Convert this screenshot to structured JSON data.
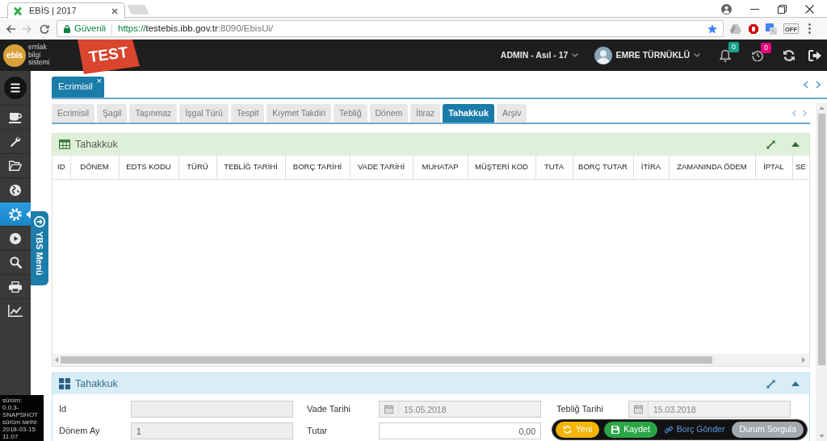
{
  "browser": {
    "tab_title": "EBİS | 2017",
    "forward_disabled": true,
    "security_label": "Güvenli",
    "url": {
      "scheme": "https://",
      "host": "testebis.ibb.gov.tr",
      "path": ":8090/EbisUi/"
    },
    "extension_label": "OFF"
  },
  "header": {
    "logo": "ebis",
    "tagline": [
      "emlak",
      "bilgi",
      "sistemi"
    ],
    "environment": "TEST",
    "role": "ADMIN - Asıl - 17",
    "user": "EMRE TÜRNÜKLÜ",
    "indicators": [
      {
        "badge": "0",
        "color": "#1aa38b"
      },
      {
        "badge": "0",
        "color": "#e6007e"
      }
    ]
  },
  "sidebar": {
    "items": [
      {
        "selected": false
      },
      {
        "selected": false
      },
      {
        "selected": false
      },
      {
        "selected": false
      },
      {
        "selected": true
      },
      {
        "selected": false
      },
      {
        "selected": false
      },
      {
        "selected": false
      },
      {
        "selected": false
      }
    ],
    "side_tab": "YBS Menü",
    "build_info": [
      {
        "label": "sürüm:",
        "value": "0.0.3-SNAPSHOT"
      },
      {
        "label": "sürüm tarihi:",
        "value": "2018-03-15 11:07"
      }
    ]
  },
  "page_tabs": [
    {
      "label": "Ecrimisil",
      "close": "×",
      "selected": true
    }
  ],
  "sub_tabs": [
    {
      "label": "Ecrimisil",
      "selected": false
    },
    {
      "label": "Şagil",
      "selected": false
    },
    {
      "label": "Taşınmaz",
      "selected": false
    },
    {
      "label": "İşgal Türü",
      "selected": false
    },
    {
      "label": "Tespit",
      "selected": false
    },
    {
      "label": "Kıymet Takdiri",
      "selected": false
    },
    {
      "label": "Tebliğ",
      "selected": false
    },
    {
      "label": "Dönem",
      "selected": false
    },
    {
      "label": "İtiraz",
      "selected": false
    },
    {
      "label": "Tahakkuk",
      "selected": true
    },
    {
      "label": "Arşiv",
      "selected": false
    }
  ],
  "panels": [
    {
      "kind": "table",
      "title": "Tahakkuk",
      "columns": [
        "ID",
        "DÖNEM",
        "EDTS KODU",
        "TÜRÜ",
        "TEBLİĞ TARİHİ",
        "BORÇ TARİHİ",
        "VADE TARİHİ",
        "MUHATAP",
        "MÜŞTERİ KOD",
        "TUTA",
        "BORÇ TUTAR",
        "İTİRA",
        "ZAMANINDA ÖDEM",
        "İPTAL",
        "SE"
      ]
    },
    {
      "kind": "form",
      "title": "Tahakkuk",
      "fields": [
        {
          "label": "Id",
          "kind": "text",
          "disabled": true
        },
        {
          "label": "Vade Tarihi",
          "kind": "date",
          "value": "15.05.2018",
          "disabled": true
        },
        {
          "label": "Tebliğ Tarihi",
          "kind": "date",
          "value": "15.03.2018",
          "disabled": true
        },
        {
          "label": "Dönem Ay",
          "kind": "text",
          "value": "1",
          "disabled": true
        },
        {
          "label": "Tutar",
          "kind": "number",
          "value": "0,00",
          "disabled": false
        }
      ]
    }
  ],
  "actions": [
    {
      "label": "Yeni",
      "kind": "warning"
    },
    {
      "label": "Kaydet",
      "kind": "success"
    },
    {
      "label": "Borç Gönder",
      "kind": "link"
    },
    {
      "label": "Durum Sorgula",
      "kind": "secondary"
    }
  ]
}
